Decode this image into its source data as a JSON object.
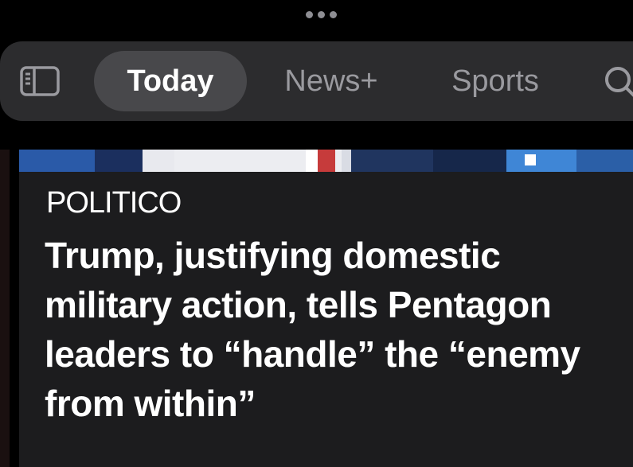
{
  "window": {
    "handle_icon": "more-dots-icon"
  },
  "toolbar": {
    "sidebar_icon": "sidebar-icon",
    "search_icon": "search-icon",
    "tabs": [
      {
        "label": "Today",
        "active": true
      },
      {
        "label": "News+",
        "active": false
      },
      {
        "label": "Sports",
        "active": false
      }
    ]
  },
  "article": {
    "publisher": "POLITICO",
    "headline": "Trump, justifying domestic military action, tells Pentagon leaders to “handle” the “enemy from within”"
  },
  "colors": {
    "background": "#000000",
    "toolbar": "#2c2c2e",
    "active_tab": "#48484b",
    "card": "#1c1c1e",
    "text_primary": "#ffffff",
    "text_secondary": "#9a9a9f"
  }
}
